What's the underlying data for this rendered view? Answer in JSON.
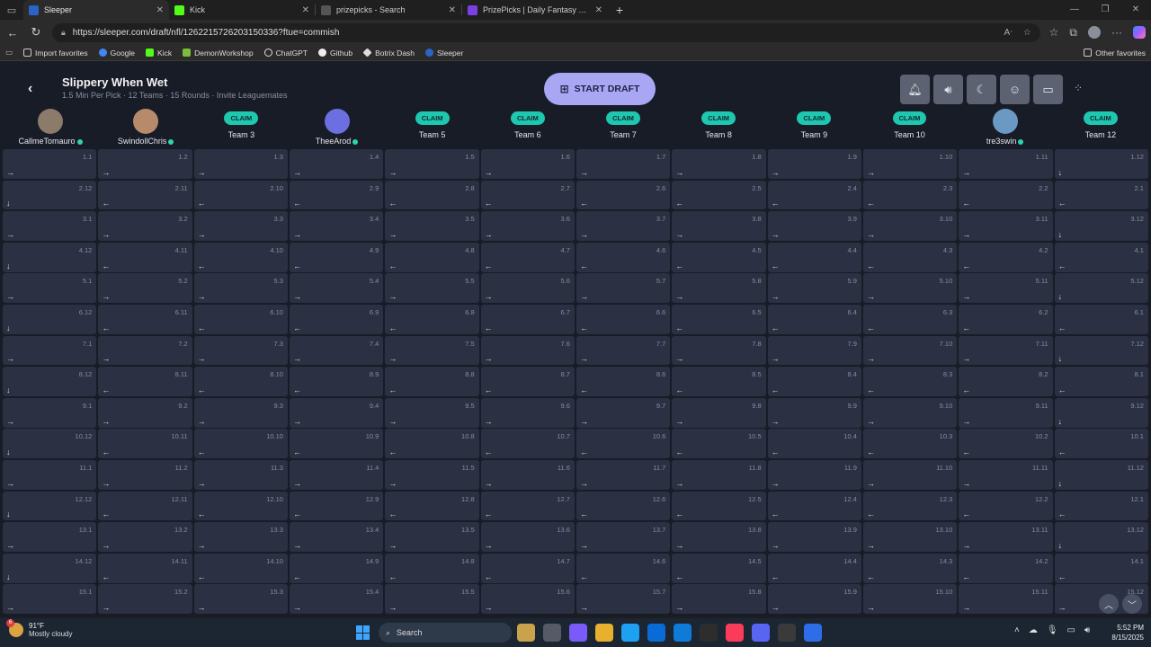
{
  "browser": {
    "tabs": [
      {
        "title": "Sleeper",
        "color": "#2a63c9",
        "active": true
      },
      {
        "title": "Kick",
        "color": "#53fc18",
        "active": false
      },
      {
        "title": "prizepicks - Search",
        "color": "#555555",
        "active": false
      },
      {
        "title": "PrizePicks | Daily Fantasy Sports",
        "color": "#7b3fe4",
        "active": false
      }
    ],
    "url": "https://sleeper.com/draft/nfl/1262215726203150336?ftue=commish",
    "favorites": [
      "Import favorites",
      "Google",
      "Kick",
      "DemonWorkshop",
      "ChatGPT",
      "Github",
      "Botrix Dash",
      "Sleeper"
    ],
    "other_favorites": "Other favorites"
  },
  "draft": {
    "league_name": "Slippery When Wet",
    "subtitle": "1.5 Min Per Pick · 12 Teams · 15 Rounds · Invite Leaguemates",
    "start_label": "START DRAFT",
    "claim_label": "CLAIM",
    "teams": [
      {
        "name": "CallmeTomauro",
        "claimed": true,
        "online": true,
        "avatar": "#8c7a6a"
      },
      {
        "name": "SwindollChris",
        "claimed": true,
        "online": true,
        "avatar": "#b88a6c"
      },
      {
        "name": "Team 3",
        "claimed": false
      },
      {
        "name": "TheeArod",
        "claimed": true,
        "online": true,
        "avatar": "#6c6fe0"
      },
      {
        "name": "Team 5",
        "claimed": false
      },
      {
        "name": "Team 6",
        "claimed": false
      },
      {
        "name": "Team 7",
        "claimed": false
      },
      {
        "name": "Team 8",
        "claimed": false
      },
      {
        "name": "Team 9",
        "claimed": false
      },
      {
        "name": "Team 10",
        "claimed": false
      },
      {
        "name": "tre3swin",
        "claimed": true,
        "online": true,
        "avatar": "#6a9ac4"
      },
      {
        "name": "Team 12",
        "claimed": false
      }
    ],
    "rounds": 15,
    "team_count": 12
  },
  "taskbar": {
    "temp": "91°F",
    "condition": "Mostly cloudy",
    "weather_badge": "6",
    "search_label": "Search",
    "time": "5:52 PM",
    "date": "8/15/2025",
    "app_colors": [
      "#c9a24b",
      "#555a66",
      "#7a5af8",
      "#e8b12d",
      "#1da1f2",
      "#0b6bd6",
      "#0f7bd9",
      "#2d2d2d",
      "#fa3c5a",
      "#5865f2",
      "#3a3a3a",
      "#2d6ee8"
    ]
  }
}
